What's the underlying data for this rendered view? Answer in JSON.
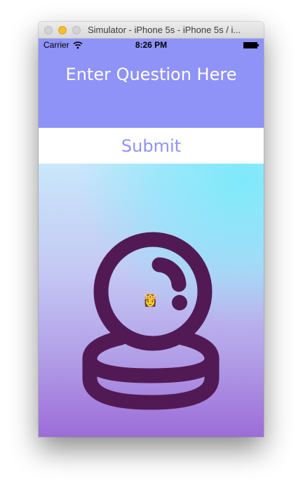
{
  "window": {
    "title": "Simulator - iPhone 5s - iPhone 5s / i..."
  },
  "status_bar": {
    "carrier": "Carrier",
    "time": "8:26 PM"
  },
  "header": {
    "question_label": "Enter Question Here"
  },
  "submit": {
    "label": "Submit"
  },
  "answer": {
    "emoji": "👸"
  },
  "colors": {
    "accent": "#8f92f7",
    "crystal_ball": "#521a55"
  },
  "icons": {
    "ball": "crystal-ball-icon"
  }
}
